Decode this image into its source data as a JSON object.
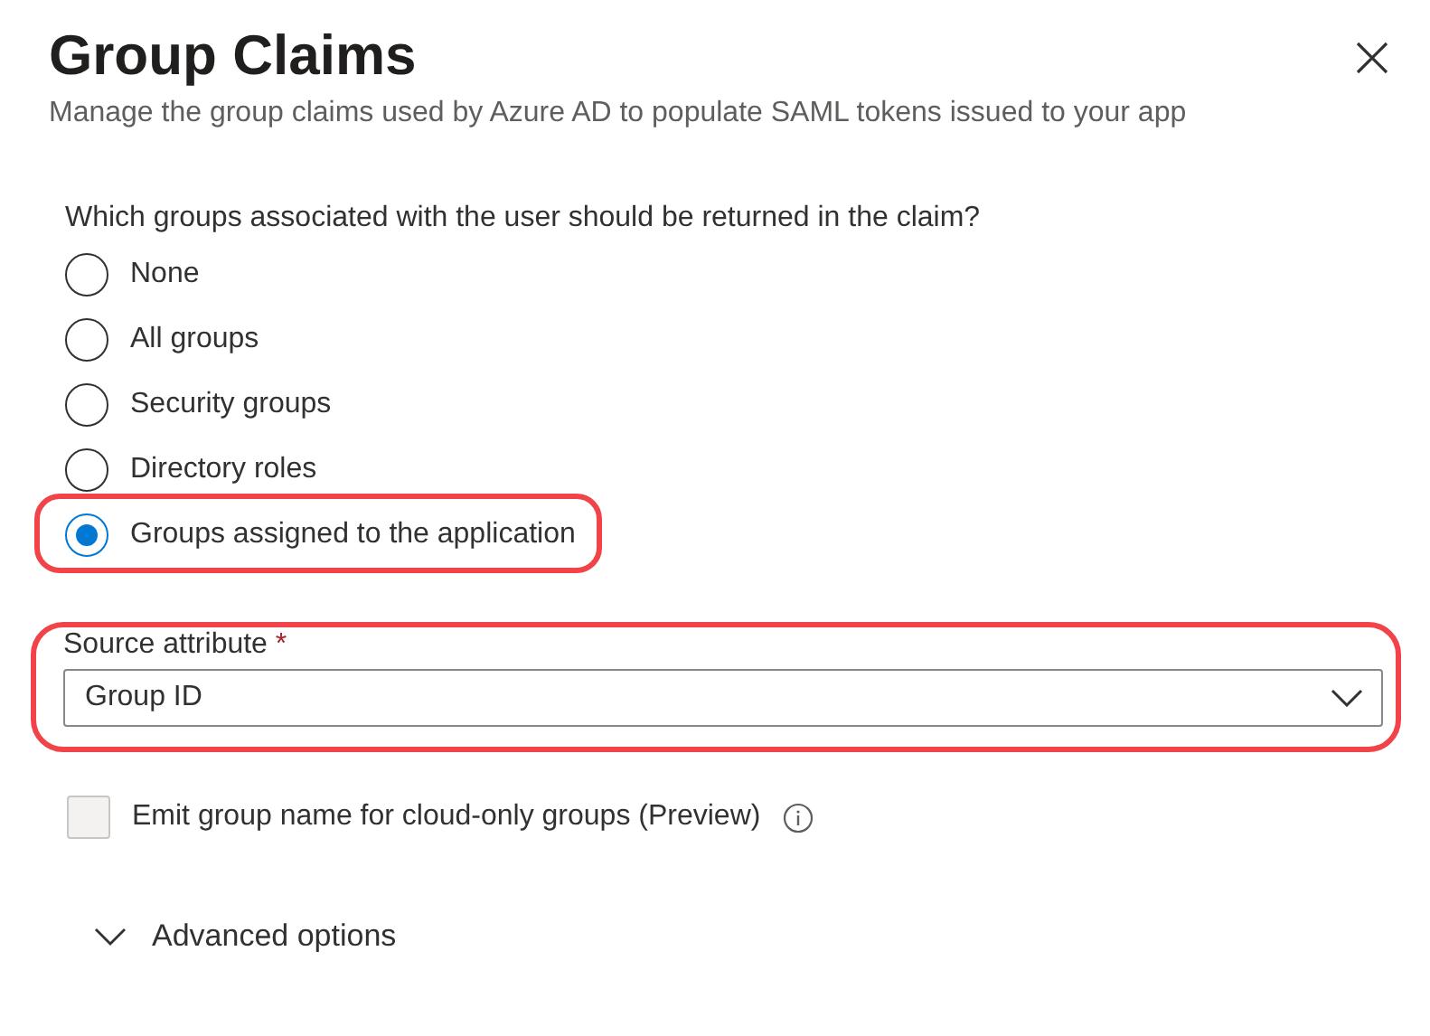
{
  "panel": {
    "title": "Group Claims",
    "subtitle": "Manage the group claims used by Azure AD to populate SAML tokens issued to your app"
  },
  "question": "Which groups associated with the user should be returned in the claim?",
  "options": [
    {
      "label": "None",
      "selected": false,
      "highlighted": false
    },
    {
      "label": "All groups",
      "selected": false,
      "highlighted": false
    },
    {
      "label": "Security groups",
      "selected": false,
      "highlighted": false
    },
    {
      "label": "Directory roles",
      "selected": false,
      "highlighted": false
    },
    {
      "label": "Groups assigned to the application",
      "selected": true,
      "highlighted": true
    }
  ],
  "source_attribute": {
    "label": "Source attribute",
    "required_mark": "*",
    "value": "Group ID",
    "highlighted": true
  },
  "emit_checkbox": {
    "label": "Emit group name for cloud-only groups (Preview)",
    "checked": false,
    "disabled": true
  },
  "advanced": {
    "label": "Advanced options",
    "expanded": false
  }
}
